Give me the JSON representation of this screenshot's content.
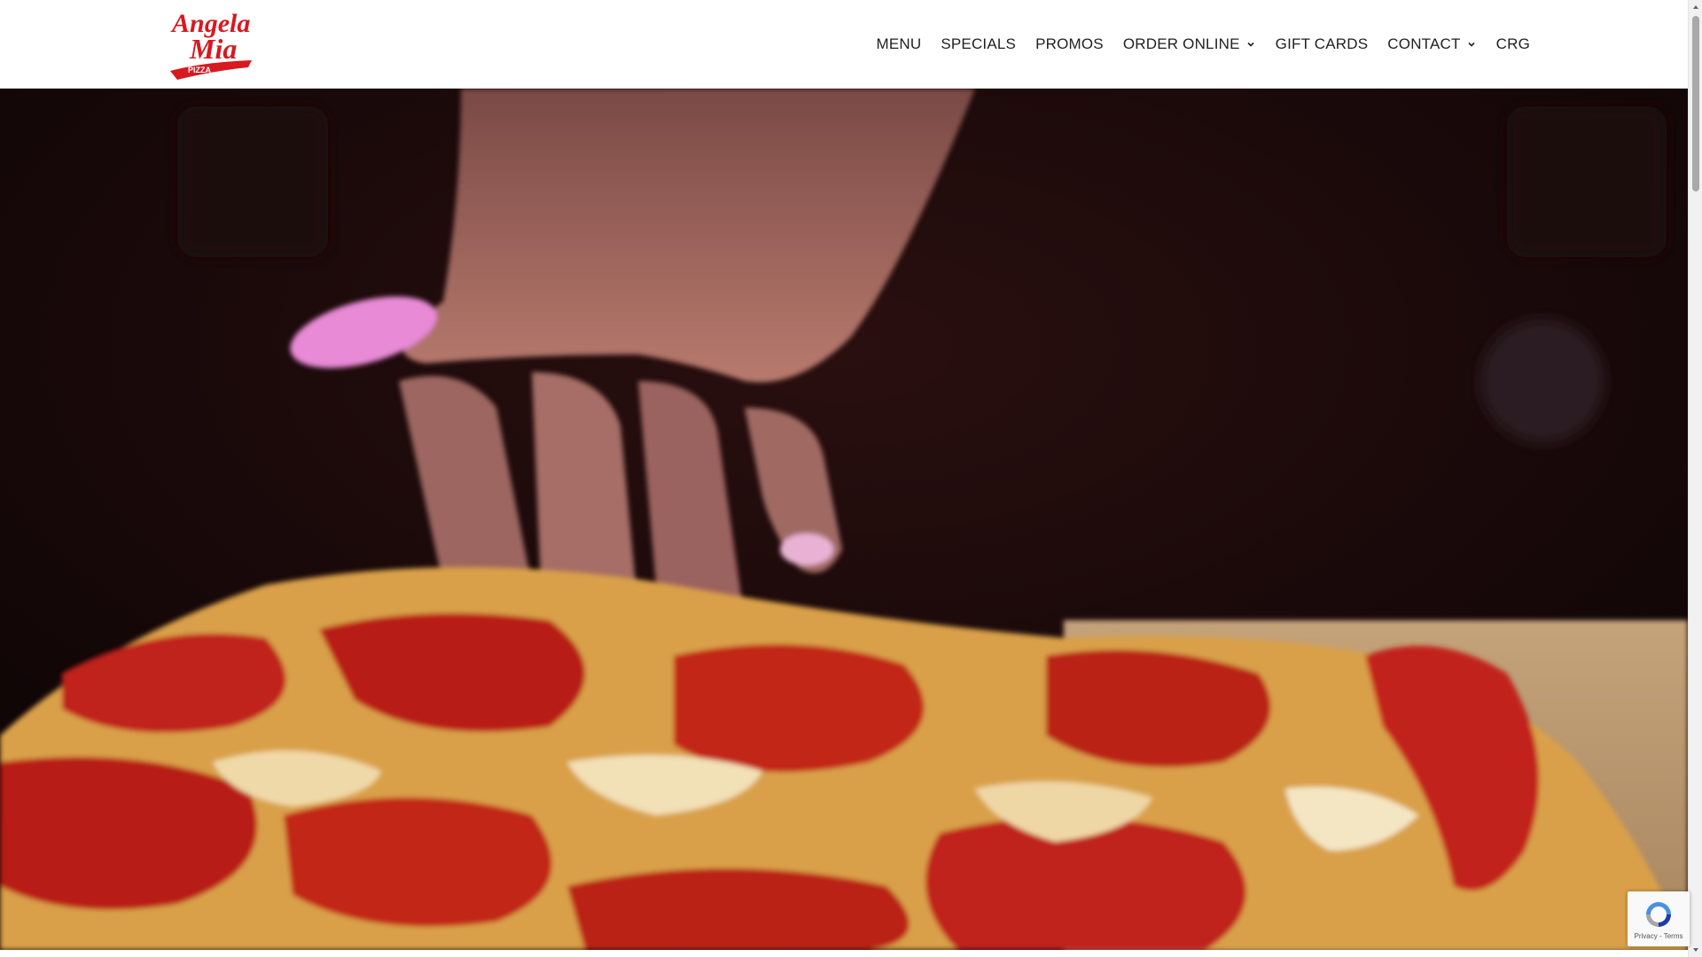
{
  "brand": {
    "logo_line1": "Angela",
    "logo_line2": "Mia",
    "logo_tag": "PIZZA",
    "logo_color": "#d71920"
  },
  "nav": {
    "items": [
      {
        "label": "MENU",
        "has_dropdown": false
      },
      {
        "label": "SPECIALS",
        "has_dropdown": false
      },
      {
        "label": "PROMOS",
        "has_dropdown": false
      },
      {
        "label": "ORDER ONLINE",
        "has_dropdown": true
      },
      {
        "label": "GIFT CARDS",
        "has_dropdown": false
      },
      {
        "label": "CONTACT",
        "has_dropdown": true
      },
      {
        "label": "CRG",
        "has_dropdown": false
      }
    ]
  },
  "hero": {
    "image": "hero-pizza-video-still",
    "accent_colors": [
      "#120607",
      "#c0231a",
      "#e8c06a"
    ]
  },
  "recaptcha": {
    "label": "Privacy - Terms"
  }
}
